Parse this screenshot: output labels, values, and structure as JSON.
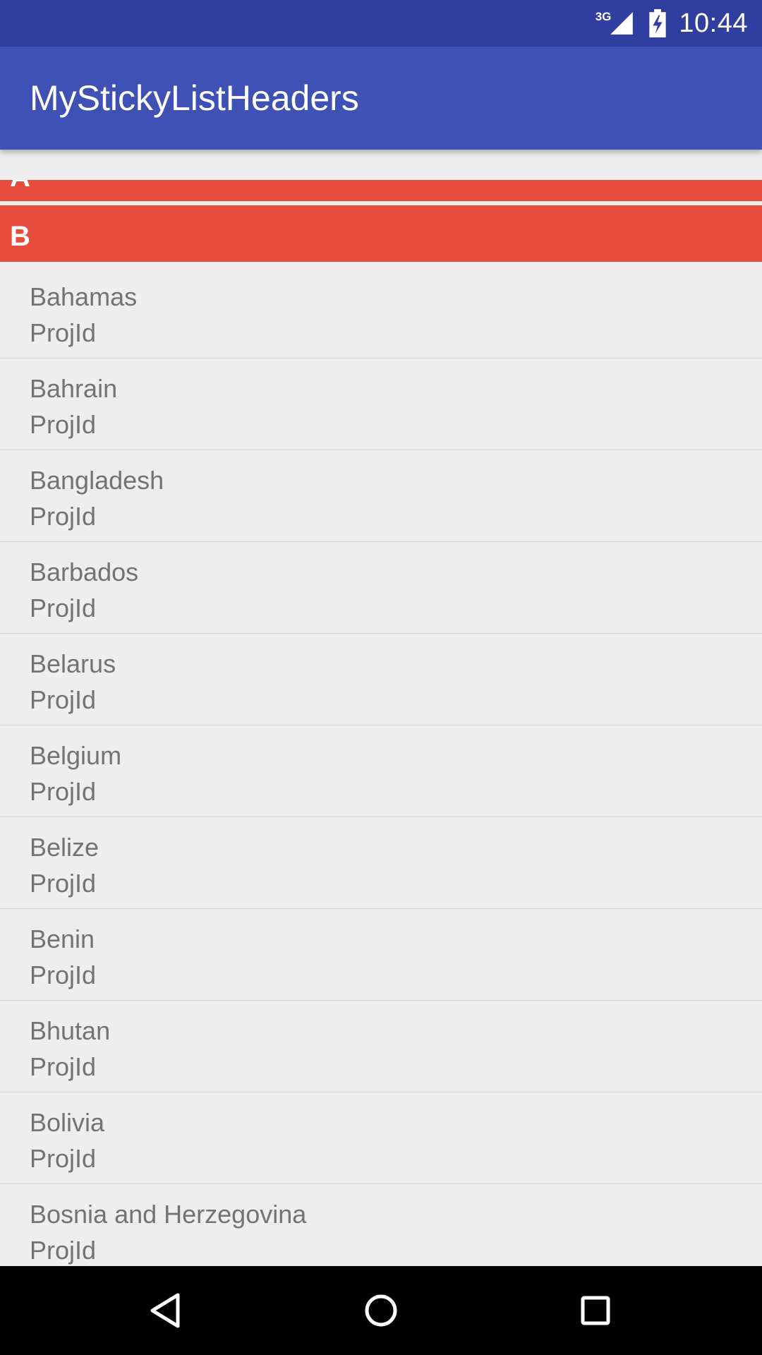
{
  "status_bar": {
    "network_type": "3G",
    "time": "10:44",
    "icons": [
      "signal-icon",
      "battery-charging-icon"
    ]
  },
  "app_bar": {
    "title": "MyStickyListHeaders"
  },
  "list": {
    "headers": [
      {
        "label": "A"
      },
      {
        "label": "B"
      }
    ],
    "items": [
      {
        "name": "Bahamas",
        "sub": "ProjId"
      },
      {
        "name": "Bahrain",
        "sub": "ProjId"
      },
      {
        "name": "Bangladesh",
        "sub": "ProjId"
      },
      {
        "name": "Barbados",
        "sub": "ProjId"
      },
      {
        "name": "Belarus",
        "sub": "ProjId"
      },
      {
        "name": "Belgium",
        "sub": "ProjId"
      },
      {
        "name": "Belize",
        "sub": "ProjId"
      },
      {
        "name": "Benin",
        "sub": "ProjId"
      },
      {
        "name": "Bhutan",
        "sub": "ProjId"
      },
      {
        "name": "Bolivia",
        "sub": "ProjId"
      },
      {
        "name": "Bosnia and Herzegovina",
        "sub": "ProjId"
      }
    ]
  },
  "nav_bar": {
    "buttons": [
      "back-icon",
      "home-icon",
      "recents-icon"
    ]
  },
  "colors": {
    "status_bar": "#303f9f",
    "app_bar": "#3f51b5",
    "section_header": "#e74c3c",
    "list_background": "#eeeeee",
    "item_text": "#737373",
    "nav_bar": "#000000"
  }
}
